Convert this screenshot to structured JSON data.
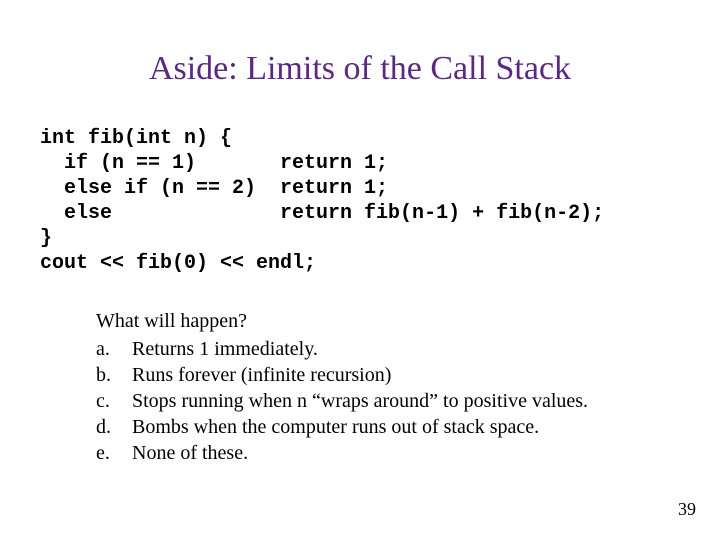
{
  "title": "Aside: Limits of the Call Stack",
  "code": "int fib(int n) {\n  if (n == 1)       return 1;\n  else if (n == 2)  return 1;\n  else              return fib(n-1) + fib(n-2);\n}\ncout << fib(0) << endl;",
  "question": "What will happen?",
  "options": [
    {
      "letter": "a.",
      "text": "Returns 1 immediately."
    },
    {
      "letter": "b.",
      "text": "Runs forever (infinite recursion)"
    },
    {
      "letter": "c.",
      "text": "Stops running when n “wraps around” to positive values."
    },
    {
      "letter": "d.",
      "text": "Bombs when the computer runs out of stack space."
    },
    {
      "letter": "e.",
      "text": "None of these."
    }
  ],
  "page_number": "39"
}
